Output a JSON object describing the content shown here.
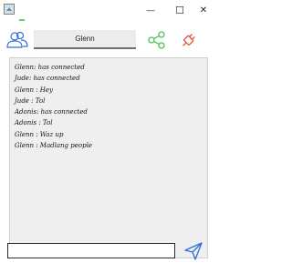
{
  "window": {
    "minimize_glyph": "—",
    "maximize_glyph": "☐",
    "close_glyph": "✕"
  },
  "header": {
    "username": "Glenn"
  },
  "icons": {
    "app": "app-icon",
    "users": "users-icon",
    "share": "share-icon",
    "disconnect": "plug-icon",
    "send": "send-icon"
  },
  "colors": {
    "users_icon": "#3b6fd4",
    "share_icon": "#4ec15a",
    "disconnect_icon": "#e2543a",
    "send_icon": "#2f6fd8",
    "status": "#69d16b"
  },
  "messages": [
    "Glenn: has connected",
    "Jude: has connected",
    "Glenn : Hey",
    "Jude : Tol",
    "Adonis: has connected",
    "Adonis : Tol",
    "Glenn : Waz up",
    "Glenn : Madlang people"
  ],
  "input": {
    "value": "",
    "placeholder": ""
  }
}
